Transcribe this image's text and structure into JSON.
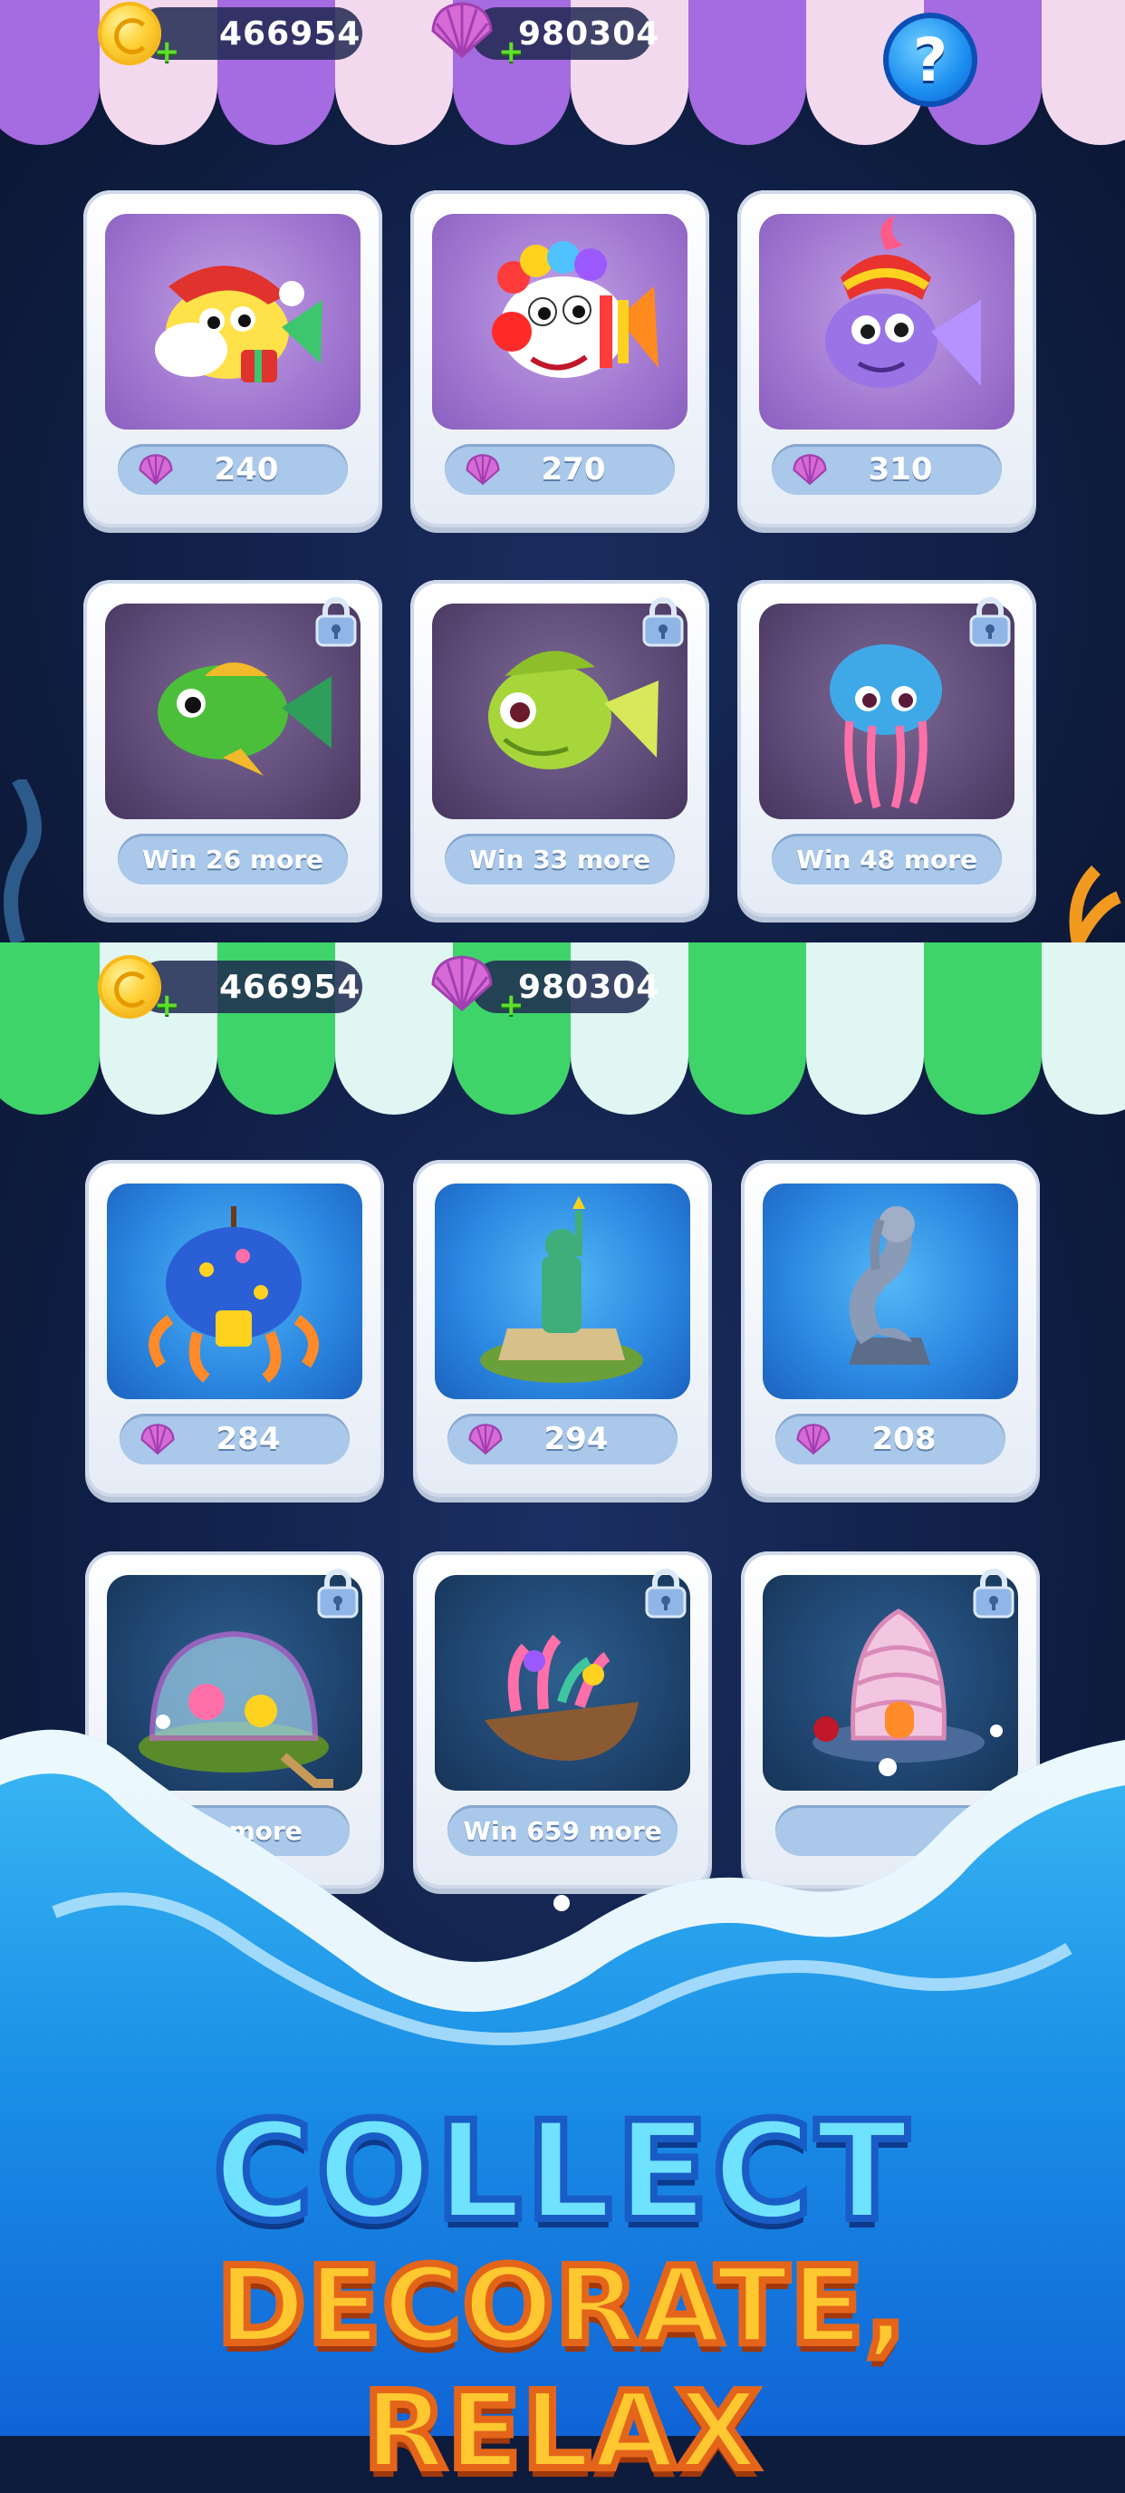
{
  "top_screen": {
    "currency": {
      "coins": "466954",
      "shells": "980304"
    },
    "help_label": "?",
    "fish": [
      {
        "name": "santa-fish",
        "price": "240",
        "locked": false
      },
      {
        "name": "clown-fish",
        "price": "270",
        "locked": false
      },
      {
        "name": "genie-fish",
        "price": "310",
        "locked": false
      },
      {
        "name": "green-fish",
        "price": "Win 26 more",
        "locked": true
      },
      {
        "name": "lime-fish",
        "price": "Win 33 more",
        "locked": true
      },
      {
        "name": "jellyfish",
        "price": "Win 48 more",
        "locked": true
      }
    ]
  },
  "bottom_screen": {
    "currency": {
      "coins": "466954",
      "shells": "980304"
    },
    "decorations": [
      {
        "name": "octopus-house",
        "price": "284",
        "locked": false
      },
      {
        "name": "statue-of-liberty",
        "price": "294",
        "locked": false
      },
      {
        "name": "mermaid-statue",
        "price": "208",
        "locked": false
      },
      {
        "name": "garden-dome",
        "price": "628 more",
        "locked": true
      },
      {
        "name": "coral-boat",
        "price": "Win 659 more",
        "locked": true
      },
      {
        "name": "shell-house",
        "price": "",
        "locked": true
      }
    ]
  },
  "banner": {
    "headline": "COLLECT",
    "tagline": "DECORATE, RELAX"
  },
  "colors": {
    "awning_top_accent": "#a56be0",
    "awning_bottom_accent": "#3fd46a",
    "awning_light": "#f3d9ee",
    "awning_light_green": "#dff6f3",
    "headline": "#6fe2ff",
    "tagline": "#ffc830"
  }
}
